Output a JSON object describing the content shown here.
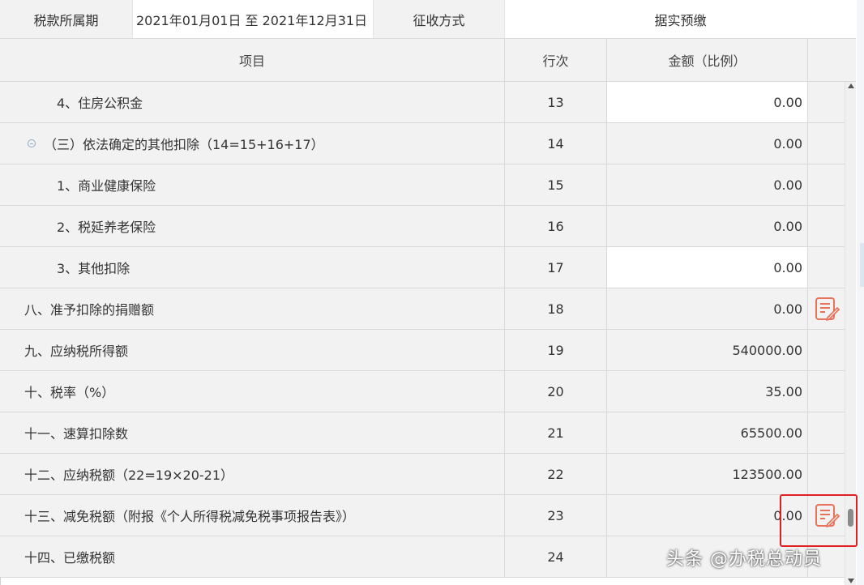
{
  "info": {
    "period_label": "税款所属期",
    "period_value": "2021年01月01日 至 2021年12月31日",
    "method_label": "征收方式",
    "method_value": "据实预缴"
  },
  "table": {
    "headers": {
      "item": "项目",
      "line": "行次",
      "amount": "金额（比例）",
      "op": ""
    },
    "rows": [
      {
        "label": "4、住房公积金",
        "line": "13",
        "amount": "0.00",
        "indent": 2,
        "editable": true,
        "edit_icon": false
      },
      {
        "label": "（三）依法确定的其他扣除（14=15+16+17）",
        "line": "14",
        "amount": "0.00",
        "indent": 1,
        "editable": false,
        "edit_icon": false,
        "collapsible": true
      },
      {
        "label": "1、商业健康保险",
        "line": "15",
        "amount": "0.00",
        "indent": 2,
        "editable": false,
        "edit_icon": false
      },
      {
        "label": "2、税延养老保险",
        "line": "16",
        "amount": "0.00",
        "indent": 2,
        "editable": false,
        "edit_icon": false
      },
      {
        "label": "3、其他扣除",
        "line": "17",
        "amount": "0.00",
        "indent": 2,
        "editable": true,
        "edit_icon": false
      },
      {
        "label": "八、准予扣除的捐赠额",
        "line": "18",
        "amount": "0.00",
        "indent": 0,
        "editable": false,
        "edit_icon": true
      },
      {
        "label": "九、应纳税所得额",
        "line": "19",
        "amount": "540000.00",
        "indent": 0,
        "editable": false,
        "edit_icon": false
      },
      {
        "label": "十、税率（%）",
        "line": "20",
        "amount": "35.00",
        "indent": 0,
        "editable": false,
        "edit_icon": false
      },
      {
        "label": "十一、速算扣除数",
        "line": "21",
        "amount": "65500.00",
        "indent": 0,
        "editable": false,
        "edit_icon": false
      },
      {
        "label": "十二、应纳税额（22=19×20-21）",
        "line": "22",
        "amount": "123500.00",
        "indent": 0,
        "editable": false,
        "edit_icon": false
      },
      {
        "label": "十三、减免税额（附报《个人所得税减免税事项报告表》）",
        "line": "23",
        "amount": "0.00",
        "indent": 0,
        "editable": false,
        "edit_icon": true
      },
      {
        "label": "十四、已缴税额",
        "line": "24",
        "amount": "",
        "indent": 0,
        "editable": false,
        "edit_icon": false
      }
    ]
  },
  "colors": {
    "edit_icon": "#e8735a",
    "highlight": "#e02020"
  },
  "watermark": "头条 @办税总动员"
}
